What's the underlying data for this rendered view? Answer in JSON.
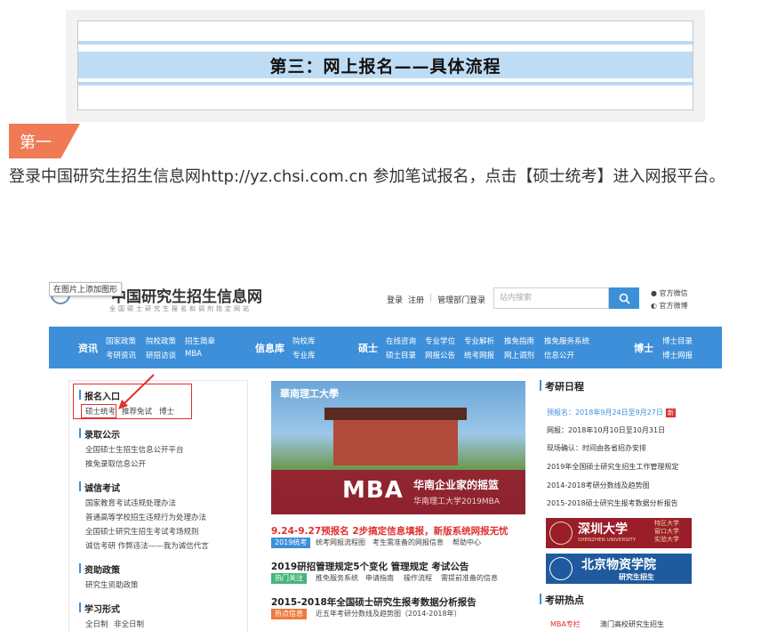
{
  "article": {
    "section_title": "第三：网上报名——具体流程",
    "step_label": "第一",
    "paragraph": "登录中国研究生招生信息网http://yz.chsi.com.cn 参加笔试报名，点击【硕士统考】进入网报平台。"
  },
  "site": {
    "tooltip": "在图片上添加图形",
    "logo_title": "中国研究生招生信息网",
    "logo_subtitle": "全国硕士研究生报名和调剂指定网站",
    "login": "登录",
    "register": "注册",
    "admin_login": "管理部门登录",
    "search_placeholder": "站内搜索",
    "wechat": "官方微信",
    "weibo": "官方微博",
    "nav": {
      "zixun": "资讯",
      "zixun_links": [
        "国家政策",
        "院校政策",
        "招生简章",
        "考研资讯",
        "研招访谈",
        "MBA"
      ],
      "xinxiku": "信息库",
      "xinxiku_links": [
        "院校库",
        "专业库"
      ],
      "shuoshi": "硕士",
      "shuoshi_links": [
        "在线咨询",
        "专业学位",
        "专业解析",
        "推免指南",
        "推免服务系统",
        "硕士目录",
        "网报公告",
        "统考网报",
        "网上调剂",
        "信息公开"
      ],
      "boshi": "博士",
      "boshi_links": [
        "博士目录",
        "博士网报"
      ]
    },
    "sidebar": [
      {
        "head": "报名入口",
        "items": [
          "硕士统考",
          "推荐免试",
          "博士"
        ]
      },
      {
        "head": "录取公示",
        "items": [
          "全国硕士生招生信息公开平台",
          "推免录取信息公开"
        ]
      },
      {
        "head": "诚信考试",
        "items": [
          "国家教育考试违规处理办法",
          "普通高等学校招生违规行为处理办法",
          "全国硕士研究生招生考试考场规则",
          "诚信考研 作弊违法——我为诚信代言"
        ]
      },
      {
        "head": "资助政策",
        "items": [
          "研究生资助政策"
        ]
      },
      {
        "head": "学习形式",
        "items": [
          "全日制",
          "非全日制"
        ]
      }
    ],
    "banner": {
      "mba": "MBA",
      "slogan": "华南企业家的摇篮",
      "slogan2": "华南理工大学2019MBA",
      "school": "華南理工大學"
    },
    "news": [
      {
        "title": "9.24-9.27预报名 2步搞定信息填报，新版系统网报无忧",
        "tag": "2019统考",
        "links": [
          "统考网报流程图",
          "考生需准备的网报信息",
          "帮助中心"
        ]
      },
      {
        "title": "2019研招管理规定5个变化 管理规定 考试公告",
        "tag": "热门关注",
        "links": [
          "推免服务系统",
          "申请指南",
          "操作流程",
          "需提前准备的信息"
        ]
      },
      {
        "title": "2015-2018年全国硕士研究生报考数据分析报告",
        "tag": "热点信息",
        "links": [
          "近五年考研分数线及趋势图（2014-2018年）"
        ]
      }
    ],
    "right": {
      "schedule_head": "考研日程",
      "schedule": [
        {
          "text": "预报名：2018年9月24日至9月27日",
          "badge": "新"
        },
        {
          "text": "网报：2018年10月10日至10月31日"
        },
        {
          "text": "现场确认：时间由各省招办安排"
        },
        {
          "text": "2019年全国硕士研究生招生工作管理规定"
        },
        {
          "text": "2014-2018考研分数线及趋势图"
        },
        {
          "text": "2015-2018硕士研究生报考数据分析报告"
        }
      ],
      "szu": "深圳大学",
      "szu_en": "SHENZHEN UNIVERSITY",
      "szu_tags": [
        "特区大学",
        "窗口大学",
        "实验大学"
      ],
      "bwu": "北京物资学院",
      "bwu_sub": "研究生招生",
      "hot_head": "考研热点",
      "hot_items": [
        "MBA专栏",
        "澳门高校研究生招生"
      ]
    }
  },
  "colors": {
    "accent": "#3d8fd9",
    "step_tag": "#f07a55",
    "highlight": "#e03030",
    "title_band": "#bfdcf5"
  }
}
